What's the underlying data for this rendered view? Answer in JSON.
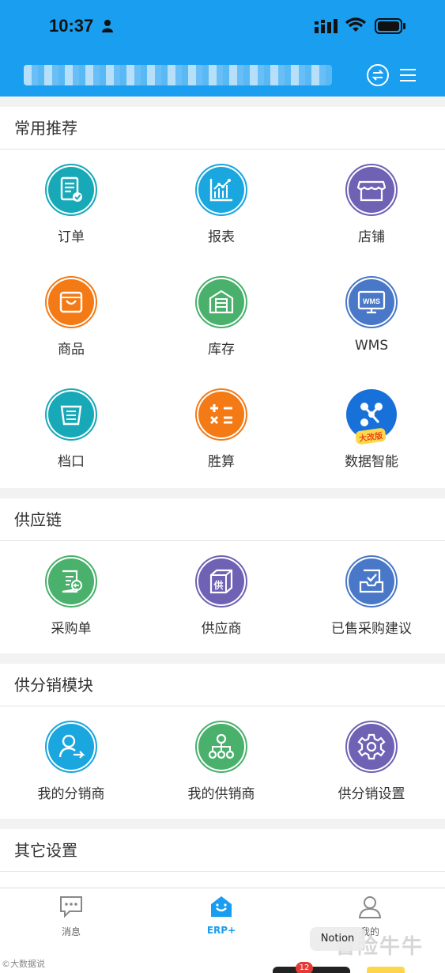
{
  "status_bar": {
    "time": "10:37"
  },
  "sections": {
    "common": {
      "title": "常用推荐",
      "items": [
        {
          "label": "订单",
          "icon": "order-list-icon",
          "color": "#17a9b7"
        },
        {
          "label": "报表",
          "icon": "report-chart-icon",
          "color": "#1aa6df"
        },
        {
          "label": "店铺",
          "icon": "store-icon",
          "color": "#6f62b4"
        },
        {
          "label": "商品",
          "icon": "product-bag-icon",
          "color": "#f47a16"
        },
        {
          "label": "库存",
          "icon": "warehouse-icon",
          "color": "#49b16c"
        },
        {
          "label": "WMS",
          "icon": "wms-monitor-icon",
          "color": "#4a78c8"
        },
        {
          "label": "档口",
          "icon": "stall-box-icon",
          "color": "#17a9b7"
        },
        {
          "label": "胜算",
          "icon": "calculator-icon",
          "color": "#f47a16"
        },
        {
          "label": "数据智能",
          "icon": "data-intelligence-icon",
          "color": "#1771d8",
          "badge": "大改版"
        }
      ]
    },
    "supply": {
      "title": "供应链",
      "items": [
        {
          "label": "采购单",
          "icon": "purchase-order-icon",
          "color": "#49b16c"
        },
        {
          "label": "供应商",
          "icon": "supplier-box-icon",
          "color": "#6f62b4"
        },
        {
          "label": "已售采购建议",
          "icon": "purchase-suggestion-icon",
          "color": "#4a78c8"
        }
      ]
    },
    "distribution": {
      "title": "供分销模块",
      "items": [
        {
          "label": "我的分销商",
          "icon": "distributor-user-icon",
          "color": "#1aa6df"
        },
        {
          "label": "我的供销商",
          "icon": "supplier-network-icon",
          "color": "#49b16c"
        },
        {
          "label": "供分销设置",
          "icon": "settings-gear-icon",
          "color": "#6f62b4"
        }
      ]
    },
    "other": {
      "title": "其它设置"
    }
  },
  "tabbar": {
    "tabs": [
      {
        "label": "消息",
        "icon": "message-icon"
      },
      {
        "label": "ERP+",
        "icon": "erp-home-icon",
        "active": true
      },
      {
        "label": "我的",
        "icon": "profile-icon"
      }
    ]
  },
  "overlay": {
    "notion": "Notion",
    "badge_count": "12",
    "watermark_right": "冒险牛牛",
    "watermark_left": "©大数据说"
  }
}
